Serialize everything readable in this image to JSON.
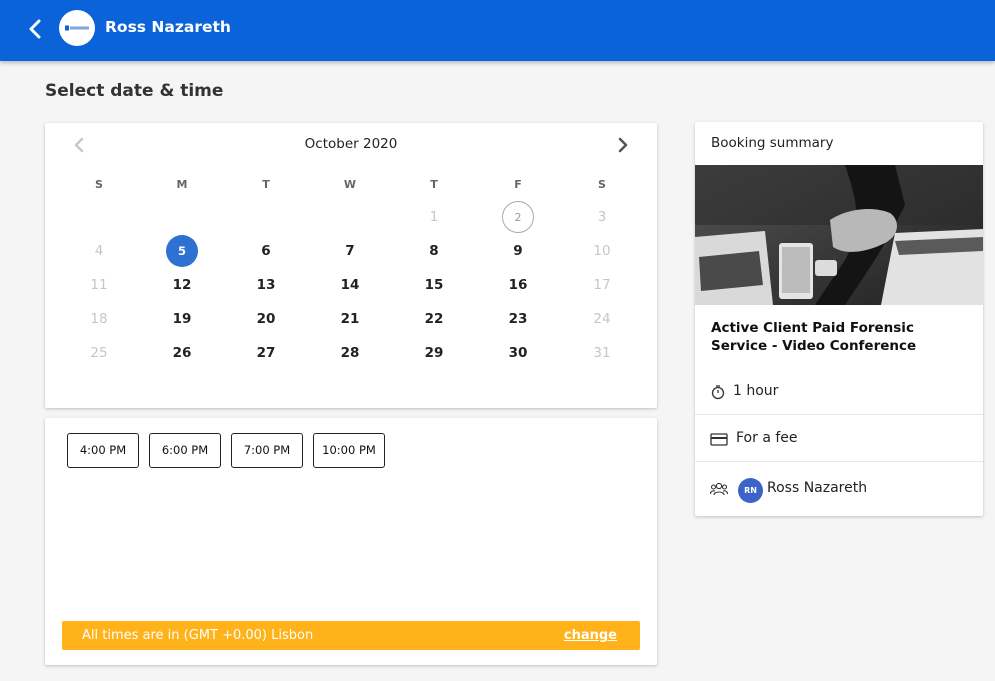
{
  "header": {
    "host_name": "Ross Nazareth",
    "logo_text": "Ross Forensics",
    "colors": {
      "bar": "#0a63d8"
    }
  },
  "page": {
    "title": "Select date & time"
  },
  "calendar": {
    "month_label": "October 2020",
    "weekdays": [
      "S",
      "M",
      "T",
      "W",
      "T",
      "F",
      "S"
    ],
    "weeks": [
      [
        null,
        null,
        null,
        null,
        "1",
        "2",
        "3"
      ],
      [
        "4",
        "5",
        "6",
        "7",
        "8",
        "9",
        "10"
      ],
      [
        "11",
        "12",
        "13",
        "14",
        "15",
        "16",
        "17"
      ],
      [
        "18",
        "19",
        "20",
        "21",
        "22",
        "23",
        "24"
      ],
      [
        "25",
        "26",
        "27",
        "28",
        "29",
        "30",
        "31"
      ]
    ],
    "selected_day": "5",
    "today_day": "2",
    "unavailable_days": [
      "1",
      "2",
      "3",
      "4",
      "10",
      "11",
      "17",
      "18",
      "24",
      "25",
      "31"
    ],
    "colors": {
      "selected": "#2d72d2"
    }
  },
  "times": {
    "slots": [
      "4:00 PM",
      "6:00 PM",
      "7:00 PM",
      "10:00 PM"
    ],
    "timezone_text": "All times are in (GMT +0.00) Lisbon",
    "change_label": "change",
    "colors": {
      "timezone_bar": "#ffb219"
    }
  },
  "summary": {
    "title": "Booking summary",
    "service_name": "Active Client Paid Forensic Service - Video Conference",
    "duration": "1 hour",
    "price": "For a fee",
    "host": "Ross Nazareth",
    "host_initials": "RN",
    "icons": {
      "duration": "stopwatch-icon",
      "price": "credit-card-icon",
      "host": "people-icon"
    }
  }
}
